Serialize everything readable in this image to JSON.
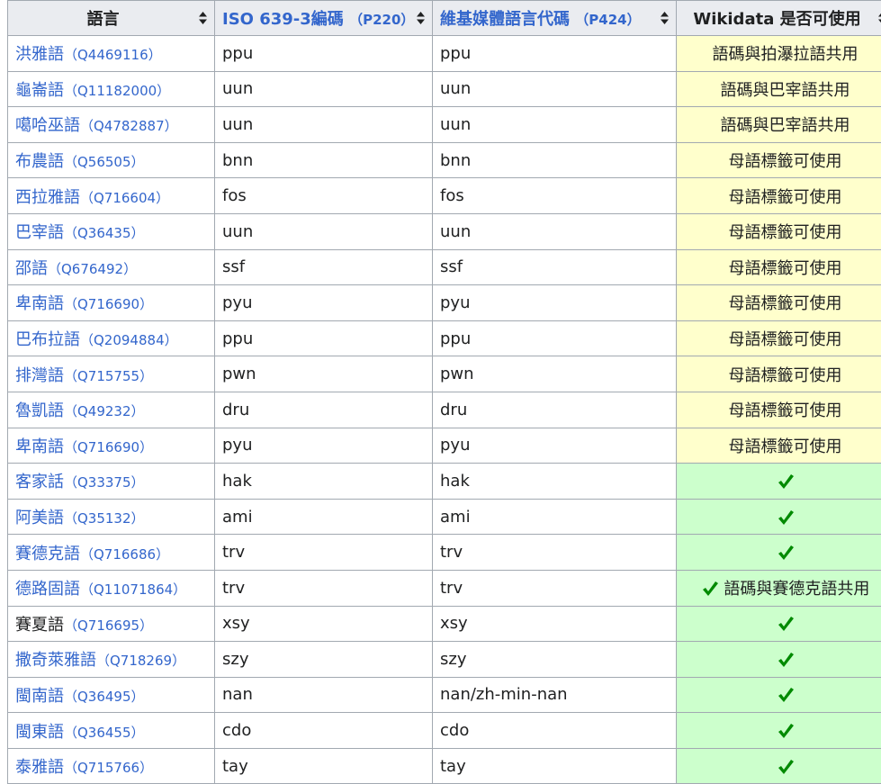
{
  "headers": {
    "language": "語言",
    "iso_link": "ISO 639-3編碼",
    "iso_pid": "（P220）",
    "wiki_link": "維基媒體語言代碼",
    "wiki_pid": "（P424）",
    "usable": "Wikidata 是否可使用"
  },
  "colors": {
    "link": "#3366cc",
    "yellow_cell": "#ffffcc",
    "green_cell": "#ccffcc",
    "check": "#008a00",
    "header_bg": "#eaecf0",
    "border": "#a2a9b1"
  },
  "rows": [
    {
      "name": "洪雅語",
      "qid": "（Q4469116）",
      "iso": "ppu",
      "wiki": "ppu",
      "note": "語碼與拍瀑拉語共用",
      "status": "yellow",
      "check": false
    },
    {
      "name": "龜崙語",
      "qid": "（Q11182000）",
      "iso": "uun",
      "wiki": "uun",
      "note": "語碼與巴宰語共用",
      "status": "yellow",
      "check": false
    },
    {
      "name": "噶哈巫語",
      "qid": "（Q4782887）",
      "iso": "uun",
      "wiki": "uun",
      "note": "語碼與巴宰語共用",
      "status": "yellow",
      "check": false
    },
    {
      "name": "布農語",
      "qid": "（Q56505）",
      "iso": "bnn",
      "wiki": "bnn",
      "note": "母語標籤可使用",
      "status": "yellow",
      "check": false
    },
    {
      "name": "西拉雅語",
      "qid": "（Q716604）",
      "iso": "fos",
      "wiki": "fos",
      "note": "母語標籤可使用",
      "status": "yellow",
      "check": false
    },
    {
      "name": "巴宰語",
      "qid": "（Q36435）",
      "iso": "uun",
      "wiki": "uun",
      "note": "母語標籤可使用",
      "status": "yellow",
      "check": false
    },
    {
      "name": "邵語",
      "qid": "（Q676492）",
      "iso": "ssf",
      "wiki": "ssf",
      "note": "母語標籤可使用",
      "status": "yellow",
      "check": false
    },
    {
      "name": "卑南語",
      "qid": "（Q716690）",
      "iso": "pyu",
      "wiki": "pyu",
      "note": "母語標籤可使用",
      "status": "yellow",
      "check": false
    },
    {
      "name": "巴布拉語",
      "qid": "（Q2094884）",
      "iso": "ppu",
      "wiki": "ppu",
      "note": "母語標籤可使用",
      "status": "yellow",
      "check": false
    },
    {
      "name": "排灣語",
      "qid": "（Q715755）",
      "iso": "pwn",
      "wiki": "pwn",
      "note": "母語標籤可使用",
      "status": "yellow",
      "check": false
    },
    {
      "name": "魯凱語",
      "qid": "（Q49232）",
      "iso": "dru",
      "wiki": "dru",
      "note": "母語標籤可使用",
      "status": "yellow",
      "check": false
    },
    {
      "name": "卑南語",
      "qid": "（Q716690）",
      "iso": "pyu",
      "wiki": "pyu",
      "note": "母語標籤可使用",
      "status": "yellow",
      "check": false
    },
    {
      "name": "客家話",
      "qid": "（Q33375）",
      "iso": "hak",
      "wiki": "hak",
      "note": "",
      "status": "green",
      "check": true
    },
    {
      "name": "阿美語",
      "qid": "（Q35132）",
      "iso": "ami",
      "wiki": "ami",
      "note": "",
      "status": "green",
      "check": true
    },
    {
      "name": "賽德克語",
      "qid": "（Q716686）",
      "iso": "trv",
      "wiki": "trv",
      "note": "",
      "status": "green",
      "check": true
    },
    {
      "name": "德路固語",
      "qid": "（Q11071864）",
      "iso": "trv",
      "wiki": "trv",
      "note": "語碼與賽德克語共用",
      "status": "green",
      "check": true
    },
    {
      "name": "賽夏語",
      "qid": "（Q716695）",
      "iso": "xsy",
      "wiki": "xsy",
      "note": "",
      "status": "green",
      "check": true,
      "visited": true
    },
    {
      "name": "撒奇萊雅語",
      "qid": "（Q718269）",
      "iso": "szy",
      "wiki": "szy",
      "note": "",
      "status": "green",
      "check": true
    },
    {
      "name": "閩南語",
      "qid": "（Q36495）",
      "iso": "nan",
      "wiki": "nan/zh-min-nan",
      "note": "",
      "status": "green",
      "check": true
    },
    {
      "name": "閩東語",
      "qid": "（Q36455）",
      "iso": "cdo",
      "wiki": "cdo",
      "note": "",
      "status": "green",
      "check": true
    },
    {
      "name": "泰雅語",
      "qid": "（Q715766）",
      "iso": "tay",
      "wiki": "tay",
      "note": "",
      "status": "green",
      "check": true
    }
  ]
}
